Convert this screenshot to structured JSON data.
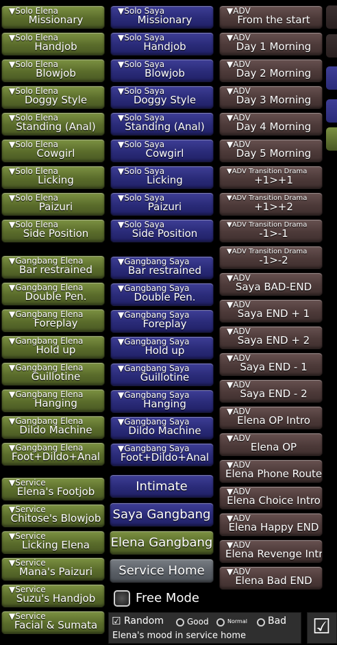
{
  "col1": [
    {
      "sub": "▼Solo Elena",
      "main": "Missionary"
    },
    {
      "sub": "▼Solo Elena",
      "main": "Handjob"
    },
    {
      "sub": "▼Solo Elena",
      "main": "Blowjob"
    },
    {
      "sub": "▼Solo Elena",
      "main": "Doggy Style"
    },
    {
      "sub": "▼Solo Elena",
      "main": "Standing (Anal)"
    },
    {
      "sub": "▼Solo Elena",
      "main": "Cowgirl"
    },
    {
      "sub": "▼Solo Elena",
      "main": "Licking"
    },
    {
      "sub": "▼Solo Elena",
      "main": "Paizuri"
    },
    {
      "sub": "▼Solo Elena",
      "main": "Side Position"
    },
    {
      "sub": "▼Gangbang Elena",
      "main": "Bar restrained"
    },
    {
      "sub": "▼Gangbang Elena",
      "main": "Double Pen."
    },
    {
      "sub": "▼Gangbang Elena",
      "main": "Foreplay"
    },
    {
      "sub": "▼Gangbang Elena",
      "main": "Hold up"
    },
    {
      "sub": "▼Gangbang Elena",
      "main": "Guillotine"
    },
    {
      "sub": "▼Gangbang Elena",
      "main": "Hanging"
    },
    {
      "sub": "▼Gangbang Elena",
      "main": "Dildo Machine"
    },
    {
      "sub": "▼Gangbang Elena",
      "main": "Foot+Dildo+Anal"
    },
    {
      "sub": "▼Service",
      "main": "Elena's Footjob"
    },
    {
      "sub": "▼Service",
      "main": "Chitose's Blowjob"
    },
    {
      "sub": "▼Service",
      "main": "Licking Elena"
    },
    {
      "sub": "▼Service",
      "main": "Mana's Paizuri"
    },
    {
      "sub": "▼Service",
      "main": "Suzu's Handjob"
    },
    {
      "sub": "▼Service",
      "main": "Facial & Sumata"
    }
  ],
  "col2": [
    {
      "sub": "▼Solo Saya",
      "main": "Missionary"
    },
    {
      "sub": "▼Solo Saya",
      "main": "Handjob"
    },
    {
      "sub": "▼Solo Saya",
      "main": "Blowjob"
    },
    {
      "sub": "▼Solo Saya",
      "main": "Doggy Style"
    },
    {
      "sub": "▼Solo Saya",
      "main": "Standing (Anal)"
    },
    {
      "sub": "▼Solo Saya",
      "main": "Cowgirl"
    },
    {
      "sub": "▼Solo Saya",
      "main": "Licking"
    },
    {
      "sub": "▼Solo Saya",
      "main": "Paizuri"
    },
    {
      "sub": "▼Solo Saya",
      "main": "Side Position"
    },
    {
      "sub": "▼Gangbang Saya",
      "main": "Bar restrained"
    },
    {
      "sub": "▼Gangbang Saya",
      "main": "Double Pen."
    },
    {
      "sub": "▼Gangbang Saya",
      "main": "Foreplay"
    },
    {
      "sub": "▼Gangbang Saya",
      "main": "Hold up"
    },
    {
      "sub": "▼Gangbang Saya",
      "main": "Guillotine"
    },
    {
      "sub": "▼Gangbang Saya",
      "main": "Hanging"
    },
    {
      "sub": "▼Gangbang Saya",
      "main": "Dildo Machine"
    },
    {
      "sub": "▼Gangbang Saya",
      "main": "Foot+Dildo+Anal"
    }
  ],
  "col3": [
    {
      "sub": "▼ADV",
      "main": "From the start"
    },
    {
      "sub": "▼ADV",
      "main": "Day 1 Morning"
    },
    {
      "sub": "▼ADV",
      "main": "Day 2 Morning"
    },
    {
      "sub": "▼ADV",
      "main": "Day 3 Morning"
    },
    {
      "sub": "▼ADV",
      "main": "Day 4 Morning"
    },
    {
      "sub": "▼ADV",
      "main": "Day 5 Morning"
    },
    {
      "sub": "▼ADV Transition Drama",
      "main": "+1>+1"
    },
    {
      "sub": "▼ADV Transition Drama",
      "main": "+1>+2"
    },
    {
      "sub": "▼ADV Transition Drama",
      "main": "-1>-1"
    },
    {
      "sub": "▼ADV Transition Drama",
      "main": "-1>-2"
    },
    {
      "sub": "▼ADV",
      "main": "Saya BAD-END"
    },
    {
      "sub": "▼ADV",
      "main": "Saya END + 1"
    },
    {
      "sub": "▼ADV",
      "main": "Saya END + 2"
    },
    {
      "sub": "▼ADV",
      "main": "Saya END - 1"
    },
    {
      "sub": "▼ADV",
      "main": "Saya END - 2"
    },
    {
      "sub": "▼ADV",
      "main": "Elena OP Intro"
    },
    {
      "sub": "▼ADV",
      "main": "Elena OP"
    },
    {
      "sub": "▼ADV",
      "main": "Elena Phone Route"
    },
    {
      "sub": "▼ADV",
      "main": "Elena Choice Intro"
    },
    {
      "sub": "▼ADV",
      "main": "Elena Happy END"
    },
    {
      "sub": "▼ADV",
      "main": "Elena Revenge Intro"
    },
    {
      "sub": "▼ADV",
      "main": "Elena Bad END"
    }
  ],
  "big_buttons": {
    "intimate": "Intimate",
    "saya_gangbang": "Saya Gangbang",
    "elena_gangbang": "Elena Gangbang",
    "service_home": "Service Home"
  },
  "free_mode": "Free Mode",
  "mood": {
    "random": "Random",
    "good": "Good",
    "normal": "Normal",
    "bad": "Bad",
    "caption": "Elena's mood in service home"
  },
  "colors": {
    "green": "#5a6c2b",
    "blue": "#2a2b78",
    "brown": "#4d3a39",
    "grey": "#5a5f66"
  }
}
